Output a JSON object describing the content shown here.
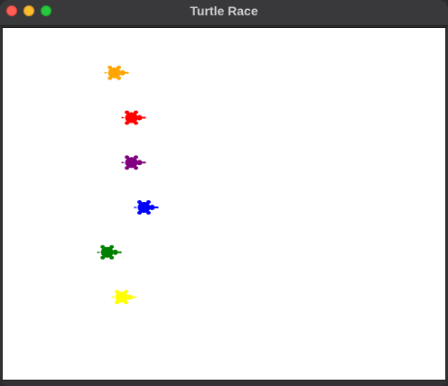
{
  "window": {
    "title": "Turtle Race"
  },
  "titlebar_buttons": [
    "close",
    "minimize",
    "zoom"
  ],
  "turtles": [
    {
      "name": "turtle-orange",
      "color": "#ffa500",
      "icon": "turtle-icon"
    },
    {
      "name": "turtle-red",
      "color": "#ff0000",
      "icon": "turtle-icon"
    },
    {
      "name": "turtle-purple",
      "color": "#800080",
      "icon": "turtle-icon"
    },
    {
      "name": "turtle-blue",
      "color": "#0000ff",
      "icon": "turtle-icon"
    },
    {
      "name": "turtle-green",
      "color": "#008000",
      "icon": "turtle-icon"
    },
    {
      "name": "turtle-yellow",
      "color": "#ffff00",
      "icon": "turtle-icon"
    }
  ]
}
